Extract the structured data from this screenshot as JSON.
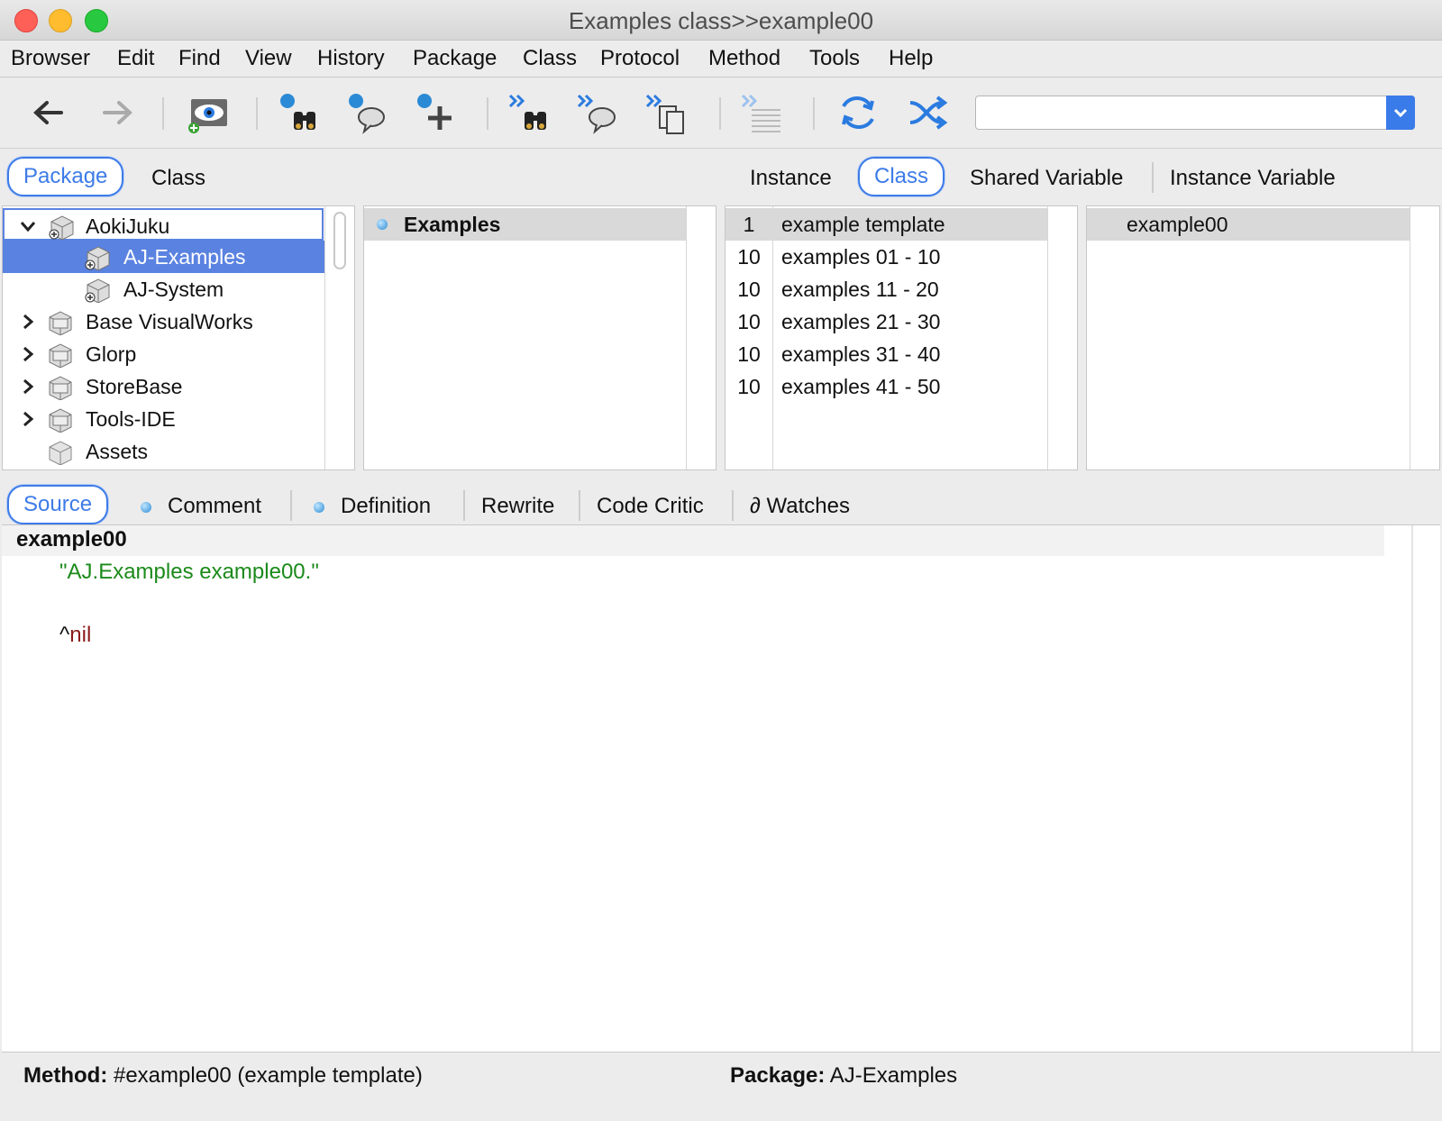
{
  "window": {
    "title": "Examples class>>example00"
  },
  "menu": [
    "Browser",
    "Edit",
    "Find",
    "View",
    "History",
    "Package",
    "Class",
    "Protocol",
    "Method",
    "Tools",
    "Help"
  ],
  "toolbar": {
    "buttons": [
      "back-arrow-icon",
      "forward-arrow-icon",
      "inspect-eye-icon",
      "find-class-binoculars-icon",
      "find-comment-icon",
      "add-icon",
      "find-next-binoculars-icon",
      "find-next-comment-icon",
      "copy-pages-icon",
      "text-lines-icon",
      "refactor-swap-icon",
      "shuffle-icon"
    ],
    "search_value": ""
  },
  "left_tabs": {
    "package": "Package",
    "class": "Class",
    "selected": "Package"
  },
  "right_tabs": {
    "instance": "Instance",
    "class": "Class",
    "shared_variable": "Shared Variable",
    "instance_variable": "Instance Variable",
    "selected": "Class"
  },
  "packages": [
    {
      "label": "AokiJuku",
      "expanded": true
    },
    {
      "label": "AJ-Examples",
      "selected": true
    },
    {
      "label": "AJ-System"
    },
    {
      "label": "Base VisualWorks",
      "expanded": false
    },
    {
      "label": "Glorp",
      "expanded": false
    },
    {
      "label": "StoreBase",
      "expanded": false
    },
    {
      "label": "Tools-IDE",
      "expanded": false
    },
    {
      "label": "Assets"
    }
  ],
  "classes": [
    {
      "label": "Examples"
    }
  ],
  "protocols": [
    {
      "count": "1",
      "label": "example template"
    },
    {
      "count": "10",
      "label": "examples 01 - 10"
    },
    {
      "count": "10",
      "label": "examples 11 - 20"
    },
    {
      "count": "10",
      "label": "examples 21 - 30"
    },
    {
      "count": "10",
      "label": "examples 31 - 40"
    },
    {
      "count": "10",
      "label": "examples 41 - 50"
    }
  ],
  "methods": [
    {
      "label": "example00"
    }
  ],
  "code_tabs": {
    "source": "Source",
    "comment": "Comment",
    "definition": "Definition",
    "rewrite": "Rewrite",
    "code_critic": "Code Critic",
    "watches": "∂ Watches",
    "selected": "Source"
  },
  "source": {
    "selector": "example00",
    "comment": "\"AJ.Examples example00.\"",
    "return_caret": "^",
    "return_value": "nil"
  },
  "status": {
    "method_label": "Method:",
    "method_value": "#example00 (example template)",
    "package_label": "Package:",
    "package_value": "AJ-Examples"
  },
  "colors": {
    "accent": "#3d7be8",
    "selection": "#5a82e0",
    "comment": "#1b8a1b",
    "keyword": "#8b1a1a"
  }
}
